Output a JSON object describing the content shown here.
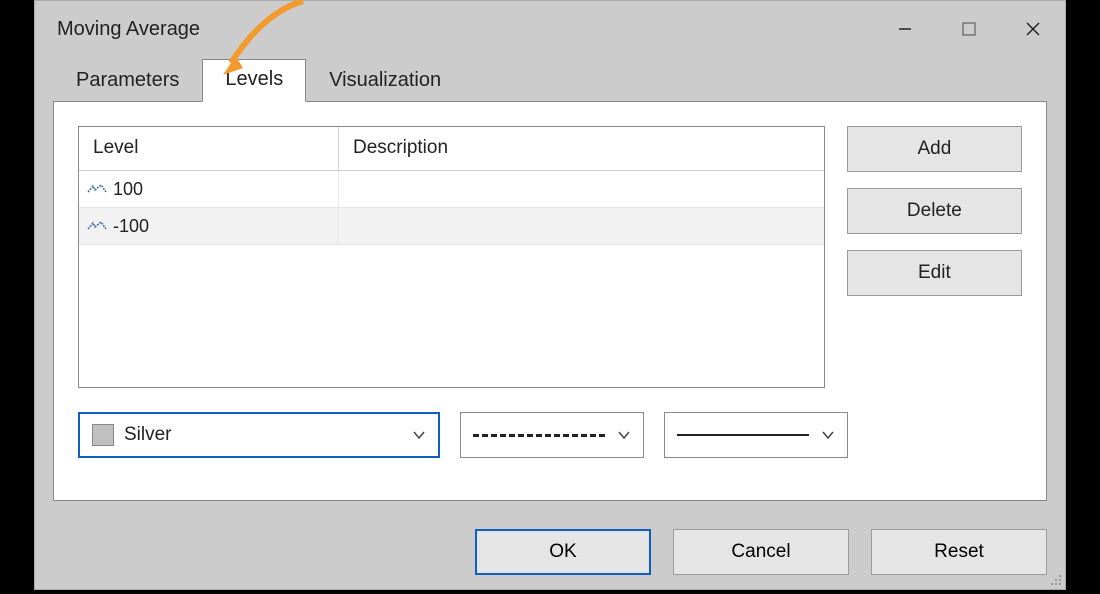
{
  "titlebar": {
    "title": "Moving Average"
  },
  "tabs": [
    {
      "label": "Parameters",
      "active": false
    },
    {
      "label": "Levels",
      "active": true
    },
    {
      "label": "Visualization",
      "active": false
    }
  ],
  "table": {
    "headers": {
      "level": "Level",
      "description": "Description"
    },
    "rows": [
      {
        "level": "100",
        "description": ""
      },
      {
        "level": "-100",
        "description": ""
      }
    ]
  },
  "side_buttons": {
    "add": "Add",
    "delete": "Delete",
    "edit": "Edit"
  },
  "style": {
    "color_name": "Silver",
    "color_hex": "#c0c0c0",
    "line_style": "dashed",
    "line_width": "1"
  },
  "bottom_buttons": {
    "ok": "OK",
    "cancel": "Cancel",
    "reset": "Reset"
  }
}
